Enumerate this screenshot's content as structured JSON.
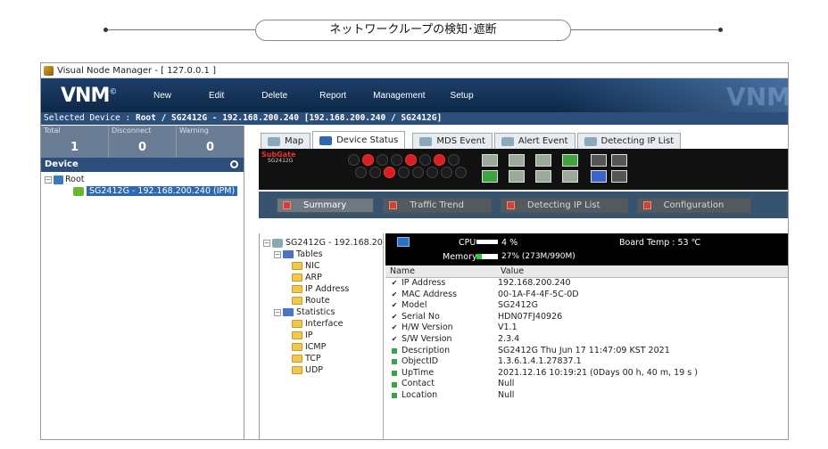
{
  "banner": {
    "title": "ネットワークループの検知･遮断"
  },
  "window": {
    "title": "Visual Node Manager - [ 127.0.0.1 ]"
  },
  "logo": "VNM",
  "menu": [
    "New",
    "Edit",
    "Delete",
    "Report",
    "Management",
    "Setup"
  ],
  "selected": {
    "label": "Selected Device :",
    "path": "Root / SG2412G - 192.168.200.240",
    "extra": "[192.168.200.240 / SG2412G]"
  },
  "stats": [
    {
      "label": "Total",
      "value": "1"
    },
    {
      "label": "Disconnect",
      "value": "0"
    },
    {
      "label": "Warning",
      "value": "0"
    }
  ],
  "device_panel": {
    "title": "Device",
    "root": "Root",
    "device": "SG2412G - 192.168.200.240 (IPM)"
  },
  "tabs": [
    "Map",
    "Device Status",
    "MDS Event",
    "Alert Event",
    "Detecting IP List"
  ],
  "device_image": {
    "brand": "SubGate",
    "model": "SG2412G"
  },
  "subtabs": [
    "Summary",
    "Traffic Trend",
    "Detecting IP List",
    "Configuration"
  ],
  "tree": {
    "root": "SG2412G - 192.168.20",
    "tables": "Tables",
    "table_items": [
      "NIC",
      "ARP",
      "IP Address",
      "Route"
    ],
    "statistics": "Statistics",
    "stat_items": [
      "Interface",
      "IP",
      "ICMP",
      "TCP",
      "UDP"
    ]
  },
  "status": {
    "cpu_label": "CPU",
    "cpu_value": "4 %",
    "memory_label": "Memory",
    "memory_value": "27% (273M/990M)",
    "memory_fraction": 0.27,
    "board_temp": "Board Temp : 53 ℃"
  },
  "props": {
    "head": [
      "Name",
      "Value"
    ],
    "rows": [
      {
        "icon": "check",
        "name": "IP Address",
        "value": "192.168.200.240"
      },
      {
        "icon": "check",
        "name": "MAC Address",
        "value": "00-1A-F4-4F-5C-0D"
      },
      {
        "icon": "check",
        "name": "Model",
        "value": "SG2412G"
      },
      {
        "icon": "check",
        "name": "Serial No",
        "value": "HDN07FJ40926"
      },
      {
        "icon": "check",
        "name": "H/W Version",
        "value": "V1.1"
      },
      {
        "icon": "check",
        "name": "S/W Version",
        "value": "2.3.4"
      },
      {
        "icon": "square",
        "name": "Description",
        "value": "SG2412G Thu Jun 17 11:47:09 KST 2021"
      },
      {
        "icon": "square",
        "name": "ObjectID",
        "value": "1.3.6.1.4.1.27837.1"
      },
      {
        "icon": "square",
        "name": "UpTime",
        "value": "2021.12.16  10:19:21  (0Days  00 h, 40 m, 19 s )"
      },
      {
        "icon": "square",
        "name": "Contact",
        "value": "Null"
      },
      {
        "icon": "square",
        "name": "Location",
        "value": "Null"
      }
    ]
  }
}
